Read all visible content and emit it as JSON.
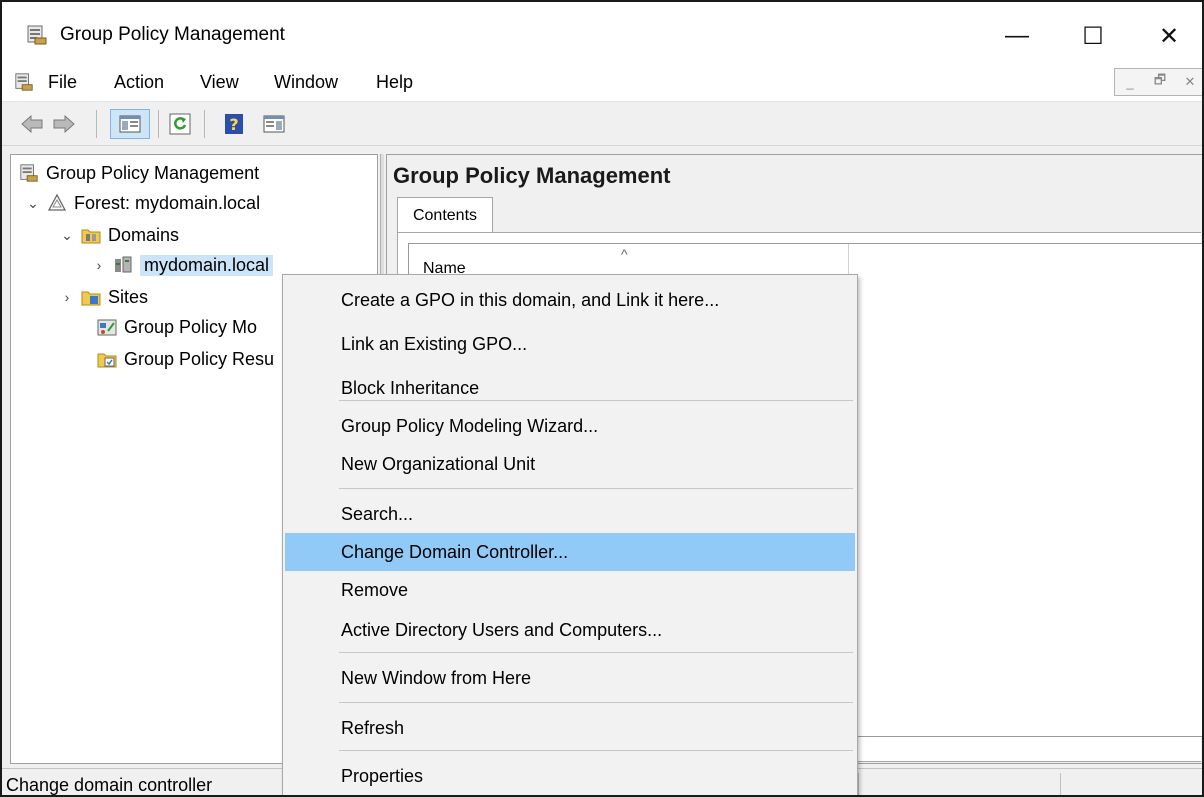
{
  "window": {
    "title": "Group Policy Management",
    "controls": {
      "minimize": "—",
      "maximize": "☐",
      "close": "✕"
    }
  },
  "menubar": {
    "items": [
      "File",
      "Action",
      "View",
      "Window",
      "Help"
    ],
    "mdi": {
      "minimize": "_",
      "restore": "🗗",
      "close": "✕"
    }
  },
  "toolbar": {
    "icons": [
      "back-arrow-icon",
      "forward-arrow-icon",
      "show-hide-console-tree-icon",
      "refresh-icon",
      "help-icon",
      "show-hide-action-pane-icon"
    ]
  },
  "tree": {
    "items": [
      {
        "label": "Group Policy Management",
        "icon": "gpm-console-icon",
        "expander": ""
      },
      {
        "label": "Forest: mydomain.local",
        "icon": "forest-icon",
        "expander": "⌄"
      },
      {
        "label": "Domains",
        "icon": "domains-folder-icon",
        "expander": "⌄"
      },
      {
        "label": "mydomain.local",
        "icon": "domain-icon",
        "expander": "›",
        "selected": true
      },
      {
        "label": "Sites",
        "icon": "sites-folder-icon",
        "expander": "›"
      },
      {
        "label": "Group Policy Mo",
        "icon": "modeling-icon",
        "expander": ""
      },
      {
        "label": "Group Policy Resu",
        "icon": "results-icon",
        "expander": ""
      }
    ]
  },
  "right_pane": {
    "title": "Group Policy Management",
    "tab": "Contents",
    "columns": [
      "Name"
    ],
    "sort_indicator": "^"
  },
  "context_menu": {
    "items": [
      "Create a GPO in this domain, and Link it here...",
      "Link an Existing GPO...",
      "Block Inheritance",
      "Group Policy Modeling Wizard...",
      "New Organizational Unit",
      "Search...",
      "Change Domain Controller...",
      "Remove",
      "Active Directory Users and Computers...",
      "New Window from Here",
      "Refresh",
      "Properties"
    ],
    "highlighted": "Change Domain Controller..."
  },
  "status": {
    "text": "Change domain controller"
  },
  "colors": {
    "highlight": "#91c9f7",
    "selection": "#cce4f7",
    "window_bg": "#f0f0f0"
  }
}
